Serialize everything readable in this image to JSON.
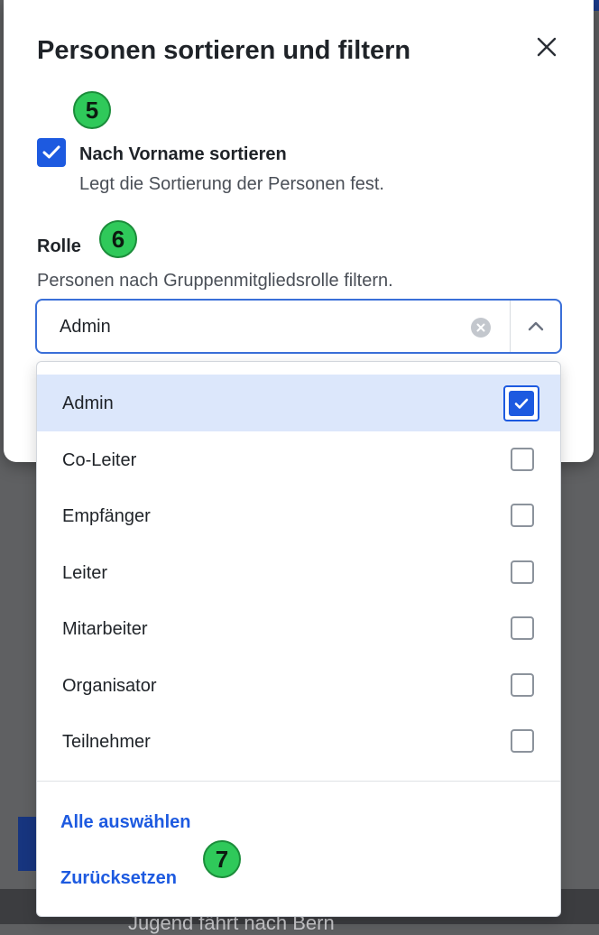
{
  "modal": {
    "title": "Personen sortieren und filtern",
    "close_icon": "close-icon"
  },
  "badges": {
    "step5": "5",
    "step6": "6",
    "step7": "7"
  },
  "sort": {
    "checked": true,
    "label": "Nach Vorname sortieren",
    "description": "Legt die Sortierung der Personen fest."
  },
  "role": {
    "heading": "Rolle",
    "description": "Personen nach Gruppenmitgliedsrolle filtern.",
    "selected_value": "Admin"
  },
  "dropdown": {
    "options": [
      {
        "label": "Admin",
        "checked": true
      },
      {
        "label": "Co-Leiter",
        "checked": false
      },
      {
        "label": "Empfänger",
        "checked": false
      },
      {
        "label": "Leiter",
        "checked": false
      },
      {
        "label": "Mitarbeiter",
        "checked": false
      },
      {
        "label": "Organisator",
        "checked": false
      },
      {
        "label": "Teilnehmer",
        "checked": false
      }
    ],
    "select_all": "Alle auswählen",
    "reset": "Zurücksetzen"
  },
  "background": {
    "text": "Jugend fährt nach Bern"
  },
  "colors": {
    "accent": "#1d5ae0",
    "badge": "#2fc95a",
    "selected_row": "#dce7fb"
  }
}
